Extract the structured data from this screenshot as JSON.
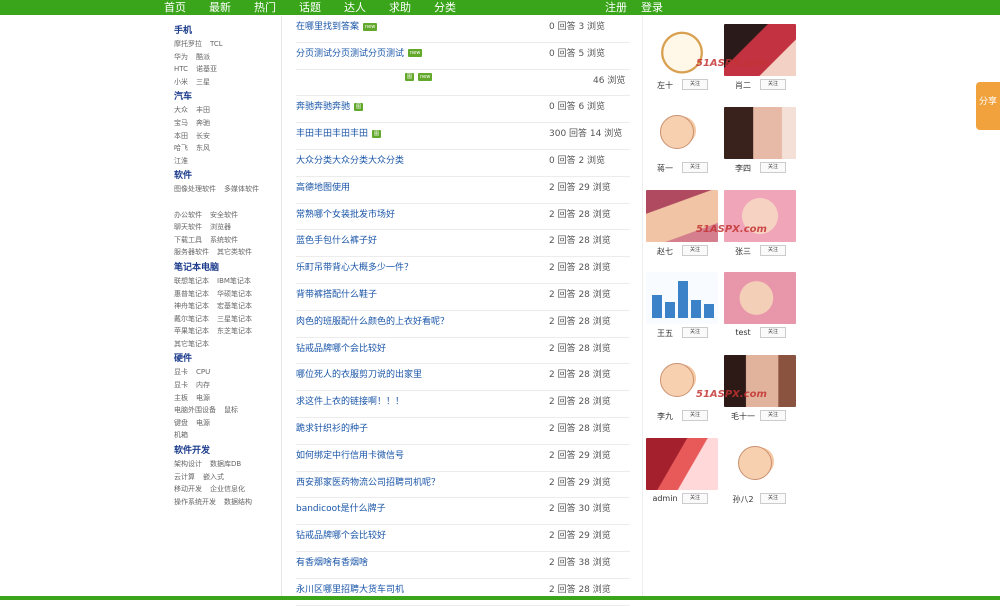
{
  "nav": {
    "items": [
      "首页",
      "最新",
      "热门",
      "话题",
      "达人",
      "求助",
      "分类"
    ],
    "right": [
      "注册",
      "登录"
    ]
  },
  "sidebar": [
    {
      "title": "手机",
      "rows": [
        [
          "摩托罗拉",
          "TCL"
        ],
        [
          "华为",
          "酷派"
        ],
        [
          "HTC",
          "诺基亚"
        ],
        [
          "小米",
          "三星"
        ]
      ]
    },
    {
      "title": "汽车",
      "rows": [
        [
          "大众",
          "丰田"
        ],
        [
          "宝马",
          "奔驰"
        ],
        [
          "本田",
          "长安"
        ],
        [
          "哈飞",
          "东风"
        ],
        [
          "江淮"
        ]
      ]
    },
    {
      "title": "软件",
      "rows": [
        [
          "图像处理软件",
          "多媒体软件"
        ],
        [
          ""
        ],
        [
          "办公软件",
          "安全软件"
        ],
        [
          "聊天软件",
          "浏览器"
        ],
        [
          "下载工具",
          "系统软件"
        ],
        [
          "服务器软件",
          "其它类软件"
        ]
      ]
    },
    {
      "title": "笔记本电脑",
      "rows": [
        [
          "联想笔记本",
          "IBM笔记本"
        ],
        [
          "惠普笔记本",
          "华硕笔记本"
        ],
        [
          "神舟笔记本",
          "宏基笔记本"
        ],
        [
          "戴尔笔记本",
          "三星笔记本"
        ],
        [
          "苹果笔记本",
          "东芝笔记本"
        ],
        [
          "其它笔记本"
        ]
      ]
    },
    {
      "title": "硬件",
      "rows": [
        [
          "显卡",
          "CPU"
        ],
        [
          "显卡",
          "内存"
        ],
        [
          "主板",
          "电源"
        ],
        [
          "电脑外围设备",
          "鼠标"
        ],
        [
          "键盘",
          "电源"
        ],
        [
          "机箱"
        ]
      ]
    },
    {
      "title": "软件开发",
      "rows": [
        [
          "架构设计",
          "数据库DB"
        ],
        [
          "云计算",
          "嵌入式"
        ],
        [
          "移动开发",
          "企业信息化"
        ],
        [
          "操作系统开发",
          "数据结构"
        ]
      ]
    }
  ],
  "questions": [
    {
      "title": "在哪里找到答案",
      "badge": "new",
      "stats": "0 回答 3 浏览"
    },
    {
      "title": "分页测试分页测试分页测试",
      "badge": "new",
      "stats": "0 回答 5 浏览"
    },
    {
      "title": "",
      "badge": "图 new",
      "stats": "46 浏览"
    },
    {
      "title": "奔驰奔驰奔驰",
      "badge": "图",
      "stats": "0 回答 6 浏览"
    },
    {
      "title": "丰田丰田丰田丰田",
      "badge": "图",
      "stats": "300 回答 14 浏览"
    },
    {
      "title": "大众分类大众分类大众分类",
      "badge": "",
      "stats": "0 回答 2 浏览"
    },
    {
      "title": "高德地图使用",
      "badge": "",
      "stats": "2 回答 29 浏览"
    },
    {
      "title": "常熟哪个女装批发市场好",
      "badge": "",
      "stats": "2 回答 28 浏览"
    },
    {
      "title": "蓝色手包什么裤子好",
      "badge": "",
      "stats": "2 回答 28 浏览"
    },
    {
      "title": "乐町吊带背心大概多少一件？",
      "badge": "",
      "stats": "2 回答 28 浏览"
    },
    {
      "title": "背带裤搭配什么鞋子",
      "badge": "",
      "stats": "2 回答 28 浏览"
    },
    {
      "title": "肉色的班服配什么颜色的上衣好看呢？",
      "badge": "",
      "stats": "2 回答 28 浏览"
    },
    {
      "title": "钻戒品牌哪个会比较好",
      "badge": "",
      "stats": "2 回答 28 浏览"
    },
    {
      "title": "哪位死人的衣服剪刀说的出家里",
      "badge": "",
      "stats": "2 回答 28 浏览"
    },
    {
      "title": "求这件上衣的链接啊！！！",
      "badge": "",
      "stats": "2 回答 28 浏览"
    },
    {
      "title": "跪求针织衫的种子",
      "badge": "",
      "stats": "2 回答 28 浏览"
    },
    {
      "title": "如何绑定中行信用卡微信号",
      "badge": "",
      "stats": "2 回答 29 浏览"
    },
    {
      "title": "西安那家医药物流公司招聘司机呢？",
      "badge": "",
      "stats": "2 回答 29 浏览"
    },
    {
      "title": "bandicoot是什么牌子",
      "badge": "",
      "stats": "2 回答 30 浏览"
    },
    {
      "title": "钻戒品牌哪个会比较好",
      "badge": "",
      "stats": "2 回答 29 浏览"
    },
    {
      "title": "有香烟啥有香烟啥",
      "badge": "",
      "stats": "2 回答 38 浏览"
    },
    {
      "title": "永川区哪里招聘大货车司机",
      "badge": "",
      "stats": "2 回答 28 浏览"
    }
  ],
  "users": {
    "follow_label": "关注",
    "watermark": "51ASPX.com",
    "list": [
      {
        "name": "左十",
        "avatar": "cartoon-face"
      },
      {
        "name": "肖二",
        "avatar": "woman-red"
      },
      {
        "name": "蒋一",
        "avatar": "cartoon-baby"
      },
      {
        "name": "李四",
        "avatar": "woman-portrait"
      },
      {
        "name": "赵七",
        "avatar": "baby-photo"
      },
      {
        "name": "张三",
        "avatar": "baby-pink"
      },
      {
        "name": "王五",
        "avatar": "bar-chart"
      },
      {
        "name": "test",
        "avatar": "baby-pink-2"
      },
      {
        "name": "李九",
        "avatar": "cartoon-baby"
      },
      {
        "name": "毛十一",
        "avatar": "woman-portrait-2"
      },
      {
        "name": "admin",
        "avatar": "red-straws"
      },
      {
        "name": "孙八2",
        "avatar": "cartoon-baby"
      }
    ]
  },
  "share_label": "分享",
  "colors": {
    "brand": "#3aa51b",
    "link": "#1a56a8",
    "category": "#1c3c8c",
    "share": "#f2a23c"
  }
}
